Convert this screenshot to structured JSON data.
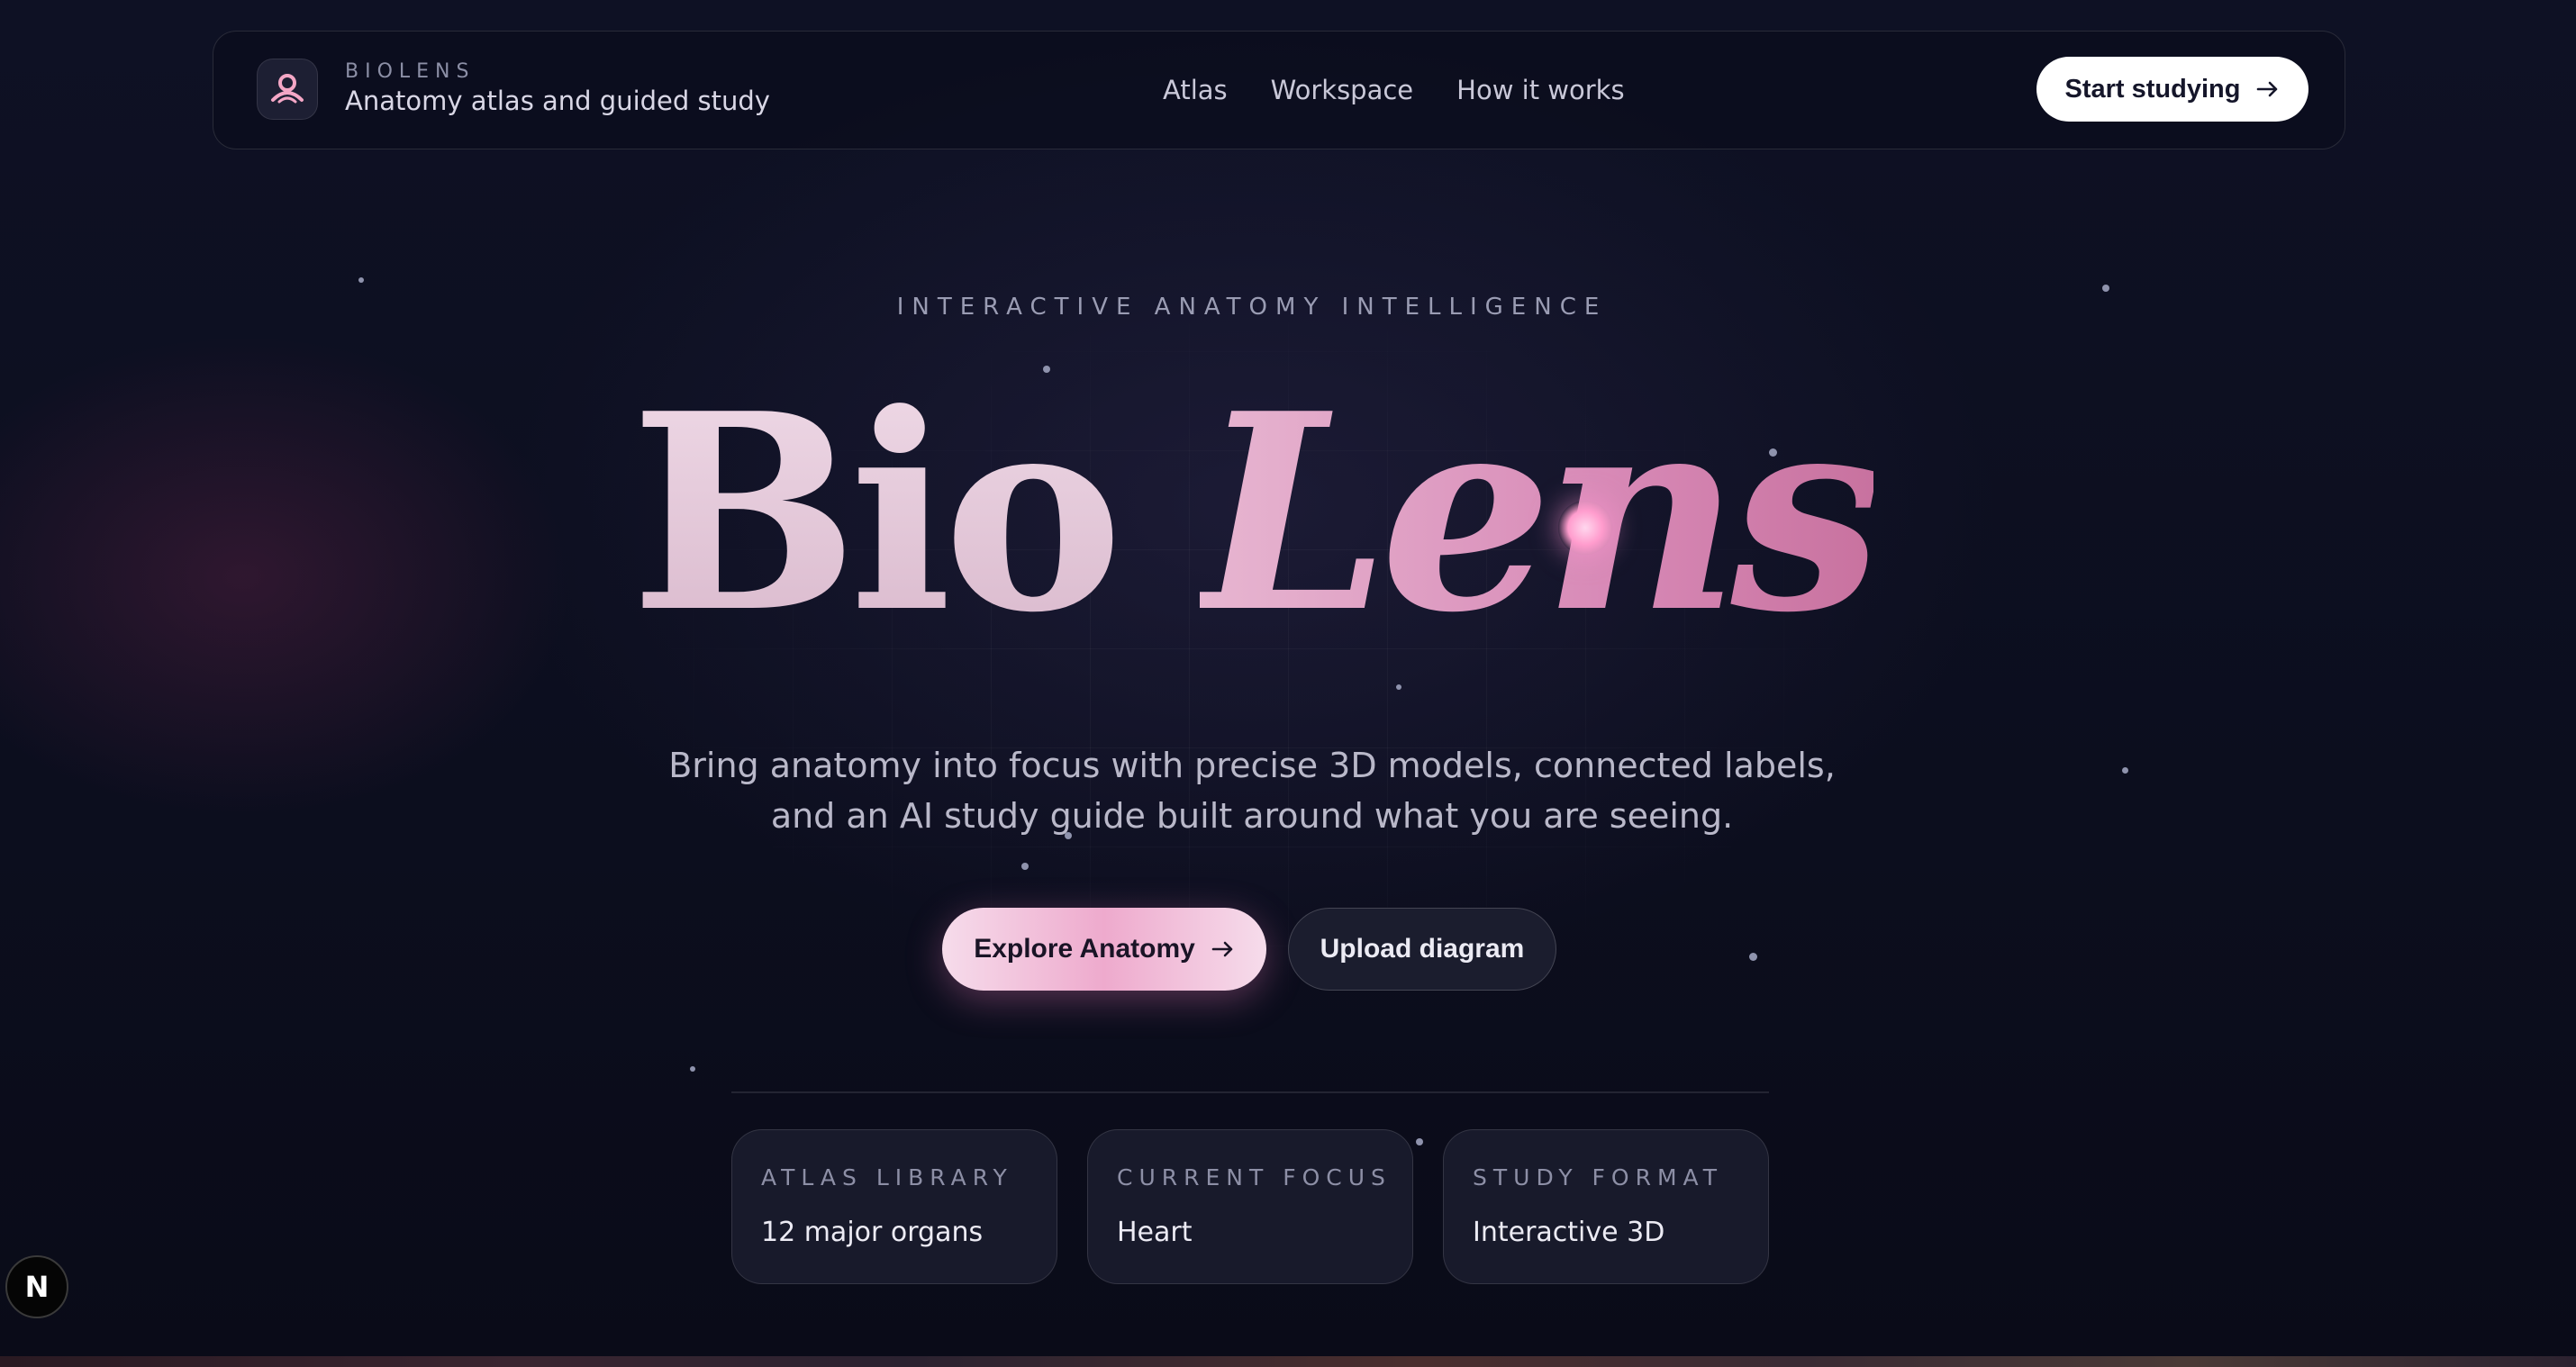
{
  "header": {
    "brand_name": "BIOLENS",
    "brand_subtitle": "Anatomy atlas and guided study",
    "nav": [
      {
        "label": "Atlas"
      },
      {
        "label": "Workspace"
      },
      {
        "label": "How it works"
      }
    ],
    "cta_label": "Start studying",
    "cta_icon": "arrow-right-icon"
  },
  "hero": {
    "eyebrow": "INTERACTIVE ANATOMY INTELLIGENCE",
    "title_part1": "Bio",
    "title_part2": "Lens",
    "subtitle_line1": "Bring anatomy into focus with precise 3D models, connected labels,",
    "subtitle_line2": "and an AI study guide built around what you are seeing.",
    "primary_button": "Explore Anatomy",
    "secondary_button": "Upload diagram"
  },
  "stats": [
    {
      "label": "ATLAS LIBRARY",
      "value": "12 major organs"
    },
    {
      "label": "CURRENT FOCUS",
      "value": "Heart"
    },
    {
      "label": "STUDY FORMAT",
      "value": "Interactive 3D"
    }
  ],
  "dev_badge": "N",
  "colors": {
    "background": "#0d0f1f",
    "accent_pink": "#e7a4c8",
    "cta_bg": "#ffffff"
  }
}
